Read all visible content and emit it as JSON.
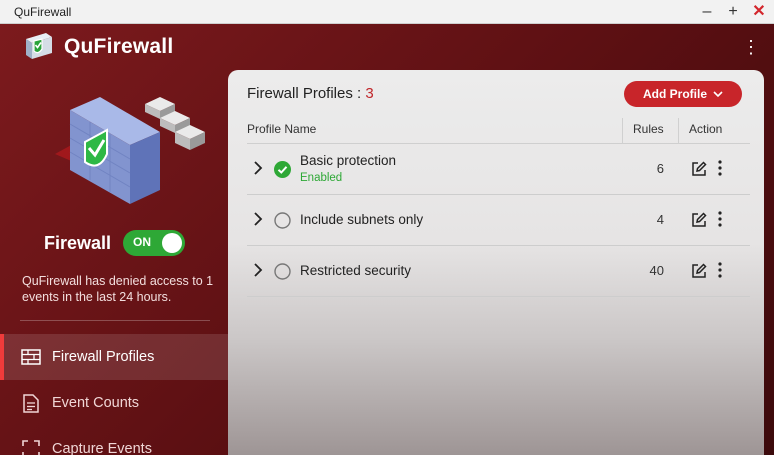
{
  "window": {
    "title": "QuFirewall"
  },
  "app": {
    "name": "QuFirewall"
  },
  "sidebar": {
    "firewall_label": "Firewall",
    "toggle_state": "ON",
    "denied_text": "QuFirewall has denied access to 1 events in the last 24 hours.",
    "nav": [
      {
        "label": "Firewall Profiles",
        "icon": "firewall-icon",
        "active": true
      },
      {
        "label": "Event Counts",
        "icon": "document-icon",
        "active": false
      },
      {
        "label": "Capture Events",
        "icon": "capture-icon",
        "active": false
      }
    ]
  },
  "panel": {
    "title": "Firewall Profiles : ",
    "count": "3",
    "add_button": "Add Profile",
    "columns": {
      "name": "Profile Name",
      "rules": "Rules",
      "action": "Action"
    },
    "profiles": [
      {
        "name": "Basic protection",
        "status": "Enabled",
        "rules": "6",
        "enabled": true
      },
      {
        "name": "Include subnets only",
        "status": "",
        "rules": "4",
        "enabled": false
      },
      {
        "name": "Restricted security",
        "status": "",
        "rules": "40",
        "enabled": false
      }
    ]
  },
  "colors": {
    "accent": "#c8252a",
    "enabled": "#2ea836"
  }
}
